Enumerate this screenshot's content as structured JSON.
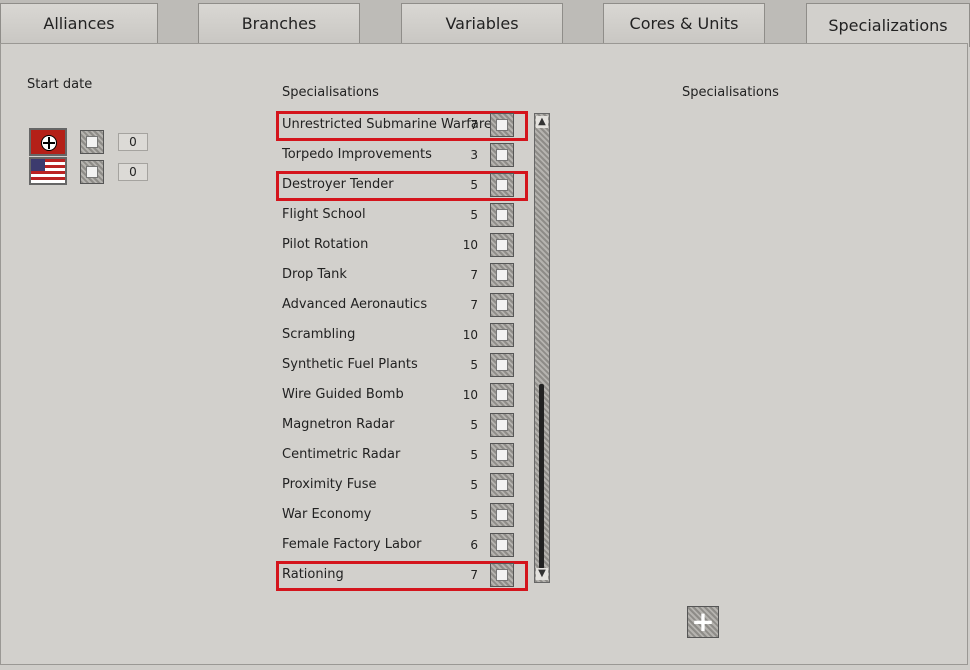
{
  "tabs": [
    {
      "label": "Alliances"
    },
    {
      "label": "Branches"
    },
    {
      "label": "Variables"
    },
    {
      "label": "Cores & Units"
    },
    {
      "label": "Specializations"
    }
  ],
  "left": {
    "start_date_label": "Start date",
    "factions": [
      {
        "flag": "germany-flag-icon",
        "value": "0"
      },
      {
        "flag": "usa-flag-icon",
        "value": "0"
      }
    ]
  },
  "middle": {
    "title": "Specialisations",
    "items": [
      {
        "name": "Unrestricted Submarine Warfare",
        "cost": "7",
        "highlighted": true
      },
      {
        "name": "Torpedo Improvements",
        "cost": "3",
        "highlighted": false
      },
      {
        "name": "Destroyer Tender",
        "cost": "5",
        "highlighted": true
      },
      {
        "name": "Flight School",
        "cost": "5",
        "highlighted": false
      },
      {
        "name": "Pilot Rotation",
        "cost": "10",
        "highlighted": false
      },
      {
        "name": "Drop Tank",
        "cost": "7",
        "highlighted": false
      },
      {
        "name": "Advanced Aeronautics",
        "cost": "7",
        "highlighted": false
      },
      {
        "name": "Scrambling",
        "cost": "10",
        "highlighted": false
      },
      {
        "name": "Synthetic Fuel Plants",
        "cost": "5",
        "highlighted": false
      },
      {
        "name": "Wire Guided Bomb",
        "cost": "10",
        "highlighted": false
      },
      {
        "name": "Magnetron Radar",
        "cost": "5",
        "highlighted": false
      },
      {
        "name": "Centimetric Radar",
        "cost": "5",
        "highlighted": false
      },
      {
        "name": "Proximity Fuse",
        "cost": "5",
        "highlighted": false
      },
      {
        "name": "War Economy",
        "cost": "5",
        "highlighted": false
      },
      {
        "name": "Female Factory Labor",
        "cost": "6",
        "highlighted": false
      },
      {
        "name": "Rationing",
        "cost": "7",
        "highlighted": true
      }
    ]
  },
  "right": {
    "title": "Specialisations",
    "add_icon": "plus-icon"
  },
  "colors": {
    "highlight": "#d4141c",
    "panel": "#d2d0cc"
  }
}
